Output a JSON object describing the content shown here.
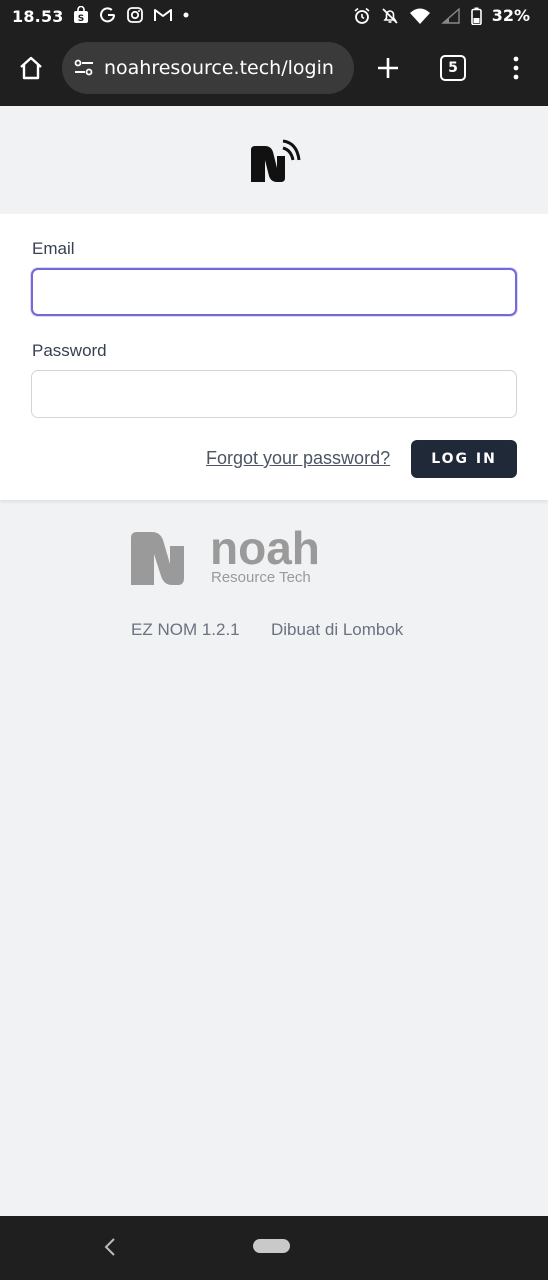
{
  "status_bar": {
    "time": "18.53",
    "battery": "32%",
    "left_icons": [
      "shopping-bag-icon",
      "g-icon",
      "instagram-icon",
      "gmail-icon",
      "dot-icon"
    ],
    "right_icons": [
      "alarm-icon",
      "bell-off-icon",
      "wifi-icon",
      "signal-icon",
      "battery-icon"
    ]
  },
  "browser": {
    "url": "noahresource.tech/login",
    "tab_count": "5"
  },
  "form": {
    "email_label": "Email",
    "email_value": "",
    "password_label": "Password",
    "password_value": "",
    "forgot_link": "Forgot your password?",
    "login_button": "LOG IN",
    "focus_color": "#7469d8"
  },
  "footer": {
    "logo_word": "noah",
    "logo_sub": "Resource Tech",
    "version": "EZ NOM 1.2.1",
    "made_in": "Dibuat di Lombok"
  }
}
